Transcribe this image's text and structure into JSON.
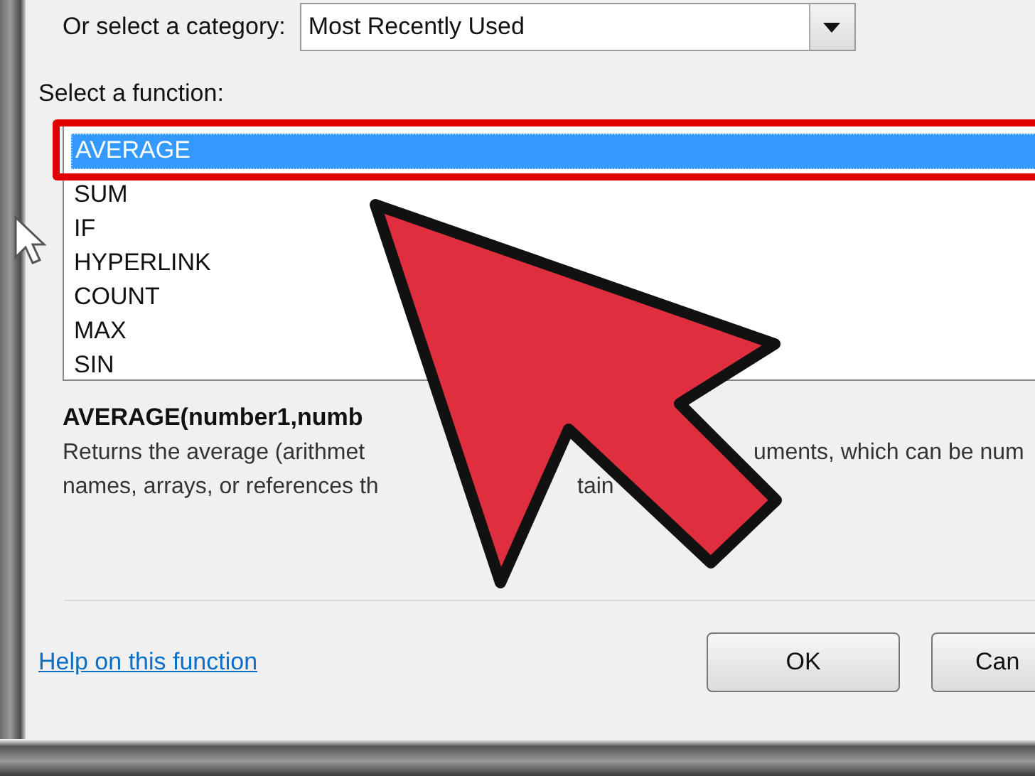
{
  "category": {
    "label": "Or select a category:",
    "value": "Most Recently Used"
  },
  "function_list": {
    "label": "Select a function:",
    "items": [
      {
        "name": "AVERAGE",
        "selected": true
      },
      {
        "name": "SUM",
        "selected": false
      },
      {
        "name": "IF",
        "selected": false
      },
      {
        "name": "HYPERLINK",
        "selected": false
      },
      {
        "name": "COUNT",
        "selected": false
      },
      {
        "name": "MAX",
        "selected": false
      },
      {
        "name": "SIN",
        "selected": false
      }
    ]
  },
  "signature": "AVERAGE(number1,numb",
  "description_lines": [
    [
      "Returns the average (arithmet",
      "uments, which can be num"
    ],
    [
      "names, arrays, or references th",
      "tain"
    ]
  ],
  "help_link": "Help on this function",
  "buttons": [
    "OK",
    "Can"
  ]
}
